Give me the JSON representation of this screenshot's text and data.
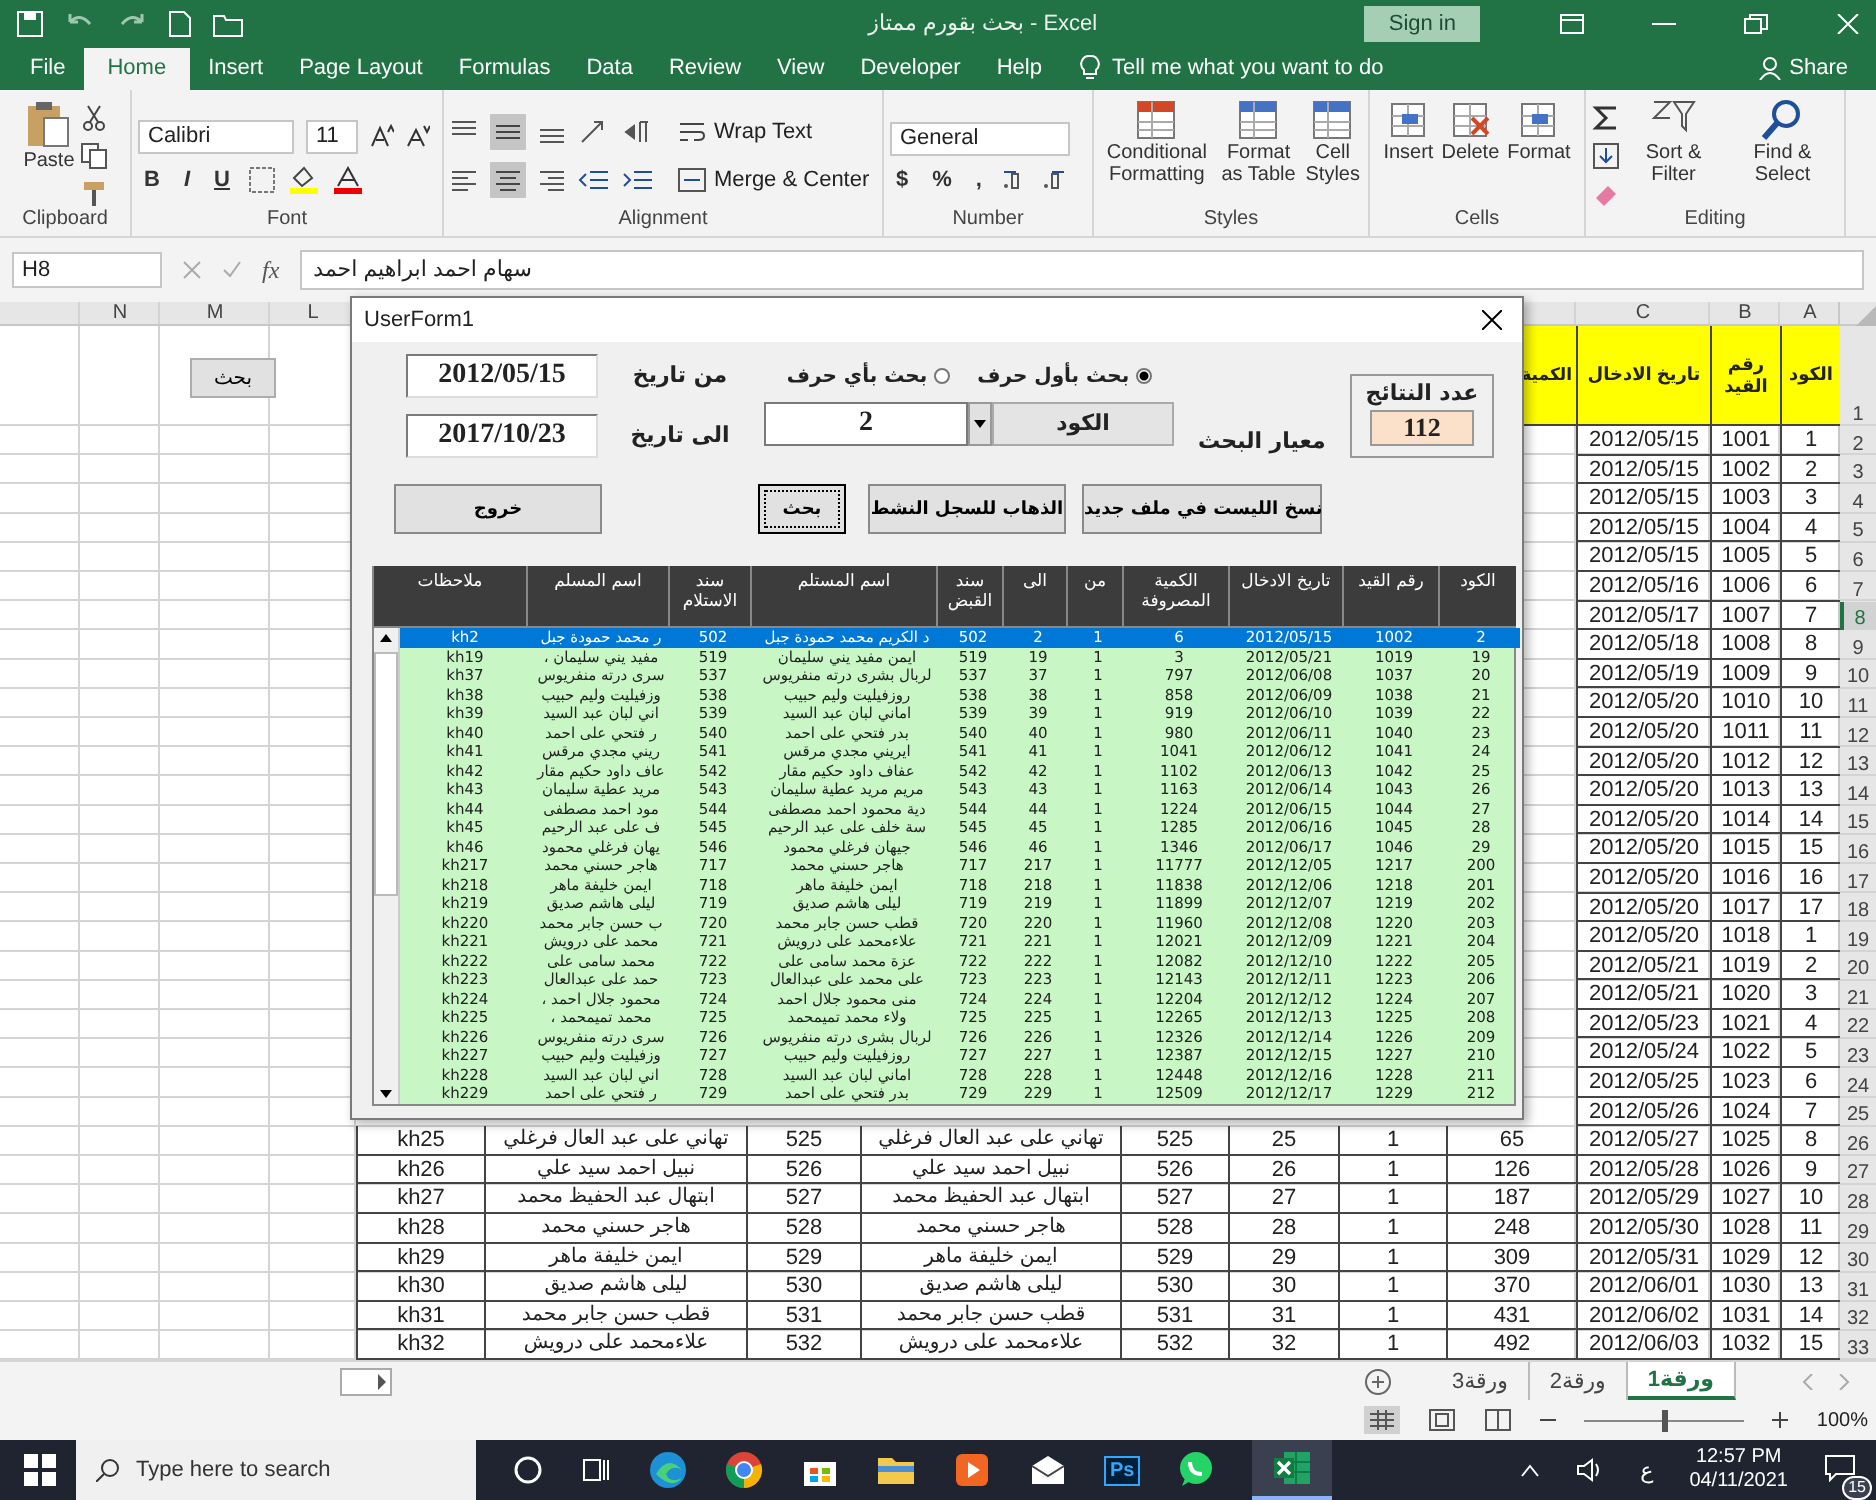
{
  "window": {
    "title": "بحث بقورم ممتاز - Excel",
    "sign_in": "Sign in"
  },
  "ribbon_tabs": [
    {
      "label": "File",
      "selected": false
    },
    {
      "label": "Home",
      "selected": true
    },
    {
      "label": "Insert",
      "selected": false
    },
    {
      "label": "Page Layout",
      "selected": false
    },
    {
      "label": "Formulas",
      "selected": false
    },
    {
      "label": "Data",
      "selected": false
    },
    {
      "label": "Review",
      "selected": false
    },
    {
      "label": "View",
      "selected": false
    },
    {
      "label": "Developer",
      "selected": false
    },
    {
      "label": "Help",
      "selected": false
    }
  ],
  "tell_me": "Tell me what you want to do",
  "share": "Share",
  "ribbon": {
    "clipboard": {
      "paste": "Paste",
      "label": "Clipboard"
    },
    "font": {
      "name": "Calibri",
      "size": "11",
      "styles": [
        "B",
        "I",
        "U"
      ],
      "label": "Font"
    },
    "alignment": {
      "wrap": "Wrap Text",
      "merge": "Merge & Center",
      "label": "Alignment"
    },
    "number": {
      "format": "General",
      "symbols": [
        "$",
        "%",
        ","
      ],
      "label": "Number"
    },
    "styles": {
      "buttons": [
        "Conditional Formatting",
        "Format as Table",
        "Cell Styles"
      ],
      "label": "Styles"
    },
    "cells": {
      "buttons": [
        "Insert",
        "Delete",
        "Format"
      ],
      "label": "Cells"
    },
    "editing": {
      "buttons": [
        "Sort & Filter",
        "Find & Select"
      ],
      "label": "Editing"
    }
  },
  "formula_bar": {
    "cell": "H8",
    "fx": "fx",
    "value": "سهام احمد ابراهيم احمد"
  },
  "sheet": {
    "columns_left": [
      "N",
      "M",
      "L"
    ],
    "columns_right": [
      "C",
      "B",
      "A"
    ],
    "button": "بحث",
    "cut_header": "الكمية",
    "rows": [
      {
        "n": "1",
        "selected": false,
        "cells": [
          "تاريخ الادخال",
          "رقم القيد",
          "الكود"
        ]
      },
      {
        "n": "2",
        "selected": false,
        "cells": [
          "2012/05/15",
          "1001",
          "1"
        ]
      },
      {
        "n": "3",
        "selected": false,
        "cells": [
          "2012/05/15",
          "1002",
          "2"
        ]
      },
      {
        "n": "4",
        "selected": false,
        "cells": [
          "2012/05/15",
          "1003",
          "3"
        ]
      },
      {
        "n": "5",
        "selected": false,
        "cells": [
          "2012/05/15",
          "1004",
          "4"
        ]
      },
      {
        "n": "6",
        "selected": false,
        "cells": [
          "2012/05/15",
          "1005",
          "5"
        ]
      },
      {
        "n": "7",
        "selected": false,
        "cells": [
          "2012/05/16",
          "1006",
          "6"
        ]
      },
      {
        "n": "8",
        "selected": true,
        "cells": [
          "2012/05/17",
          "1007",
          "7"
        ]
      },
      {
        "n": "9",
        "selected": false,
        "cells": [
          "2012/05/18",
          "1008",
          "8"
        ]
      },
      {
        "n": "10",
        "selected": false,
        "cells": [
          "2012/05/19",
          "1009",
          "9"
        ]
      },
      {
        "n": "11",
        "selected": false,
        "cells": [
          "2012/05/20",
          "1010",
          "10"
        ]
      },
      {
        "n": "12",
        "selected": false,
        "cells": [
          "2012/05/20",
          "1011",
          "11"
        ]
      },
      {
        "n": "13",
        "selected": false,
        "cells": [
          "2012/05/20",
          "1012",
          "12"
        ]
      },
      {
        "n": "14",
        "selected": false,
        "cells": [
          "2012/05/20",
          "1013",
          "13"
        ]
      },
      {
        "n": "15",
        "selected": false,
        "cells": [
          "2012/05/20",
          "1014",
          "14"
        ]
      },
      {
        "n": "16",
        "selected": false,
        "cells": [
          "2012/05/20",
          "1015",
          "15"
        ]
      },
      {
        "n": "17",
        "selected": false,
        "cells": [
          "2012/05/20",
          "1016",
          "16"
        ]
      },
      {
        "n": "18",
        "selected": false,
        "cells": [
          "2012/05/20",
          "1017",
          "17"
        ]
      },
      {
        "n": "19",
        "selected": false,
        "cells": [
          "2012/05/20",
          "1018",
          "1"
        ]
      },
      {
        "n": "20",
        "selected": false,
        "cells": [
          "2012/05/21",
          "1019",
          "2"
        ]
      },
      {
        "n": "21",
        "selected": false,
        "cells": [
          "2012/05/21",
          "1020",
          "3"
        ]
      },
      {
        "n": "22",
        "selected": false,
        "cells": [
          "2012/05/23",
          "1021",
          "4"
        ]
      },
      {
        "n": "23",
        "selected": false,
        "cells": [
          "2012/05/24",
          "1022",
          "5"
        ]
      },
      {
        "n": "24",
        "selected": false,
        "cells": [
          "2012/05/25",
          "1023",
          "6"
        ]
      },
      {
        "n": "25",
        "selected": false,
        "cells": [
          "2012/05/26",
          "1024",
          "7"
        ]
      },
      {
        "n": "26",
        "selected": false,
        "cells": [
          "kh25",
          "تهاني على عبد العال فرغلي",
          "525",
          "تهاني على عبد العال فرغلي",
          "525",
          "25",
          "1",
          "65",
          "2012/05/27",
          "1025",
          "8"
        ]
      },
      {
        "n": "27",
        "selected": false,
        "cells": [
          "kh26",
          "نبيل احمد سيد علي",
          "526",
          "نبيل احمد سيد علي",
          "526",
          "26",
          "1",
          "126",
          "2012/05/28",
          "1026",
          "9"
        ]
      },
      {
        "n": "28",
        "selected": false,
        "cells": [
          "kh27",
          "ابتهال عبد الحفيظ محمد",
          "527",
          "ابتهال عبد الحفيظ محمد",
          "527",
          "27",
          "1",
          "187",
          "2012/05/29",
          "1027",
          "10"
        ]
      },
      {
        "n": "29",
        "selected": false,
        "cells": [
          "kh28",
          "هاجر حسني محمد",
          "528",
          "هاجر حسني محمد",
          "528",
          "28",
          "1",
          "248",
          "2012/05/30",
          "1028",
          "11"
        ]
      },
      {
        "n": "30",
        "selected": false,
        "cells": [
          "kh29",
          "ايمن خليفة ماهر",
          "529",
          "ايمن خليفة ماهر",
          "529",
          "29",
          "1",
          "309",
          "2012/05/31",
          "1029",
          "12"
        ]
      },
      {
        "n": "31",
        "selected": false,
        "cells": [
          "kh30",
          "ليلى هاشم صديق",
          "530",
          "ليلى هاشم صديق",
          "530",
          "30",
          "1",
          "370",
          "2012/06/01",
          "1030",
          "13"
        ]
      },
      {
        "n": "32",
        "selected": false,
        "cells": [
          "kh31",
          "قطب حسن جابر محمد",
          "531",
          "قطب حسن جابر محمد",
          "531",
          "31",
          "1",
          "431",
          "2012/06/02",
          "1031",
          "14"
        ]
      },
      {
        "n": "33",
        "selected": false,
        "cells": [
          "kh32",
          "علاءمحمد على درويش",
          "532",
          "علاءمحمد على درويش",
          "532",
          "32",
          "1",
          "492",
          "2012/06/03",
          "1032",
          "15"
        ]
      }
    ]
  },
  "form": {
    "title": "UserForm1",
    "from_label": "من تاريخ",
    "from_value": "2012/05/15",
    "to_label": "الى تاريخ",
    "to_value": "2017/10/23",
    "radios": [
      {
        "label": "بحث بأول حرف",
        "selected": true
      },
      {
        "label": "بحث بأي حرف",
        "selected": false
      }
    ],
    "criterion_label": "معيار البحث",
    "criterion_field": "الكود",
    "search_value": "2",
    "results_label": "عدد النتائج",
    "results_count": "112",
    "buttons": [
      {
        "label": "نسخ الليست في ملف جديد",
        "focused": false
      },
      {
        "label": "الذهاب للسجل النشط",
        "focused": false
      },
      {
        "label": "بحث",
        "focused": true
      },
      {
        "label": "خروج",
        "focused": false
      }
    ],
    "list_columns": [
      "الكود",
      "رقم القيد",
      "تاريخ الادخال",
      "الكمية المصروفة",
      "من",
      "الى",
      "سند القبض",
      "اسم المستلم",
      "سند الاستلام",
      "اسم المسلم",
      "ملاحظات"
    ],
    "list_rows": [
      {
        "selected": true,
        "cells": [
          "kh2",
          "ر محمد حمودة جبل",
          "502",
          "د الكريم محمد حمودة جبل",
          "502",
          "2",
          "1",
          "6",
          "2012/05/15",
          "1002",
          "2"
        ]
      },
      {
        "selected": false,
        "cells": [
          "kh19",
          "، مفيد يني سليمان",
          "519",
          "ايمن مفيد يني سليمان",
          "519",
          "19",
          "1",
          "3",
          "2012/05/21",
          "1019",
          "19"
        ]
      },
      {
        "selected": false,
        "cells": [
          "kh37",
          "سرى درته منفريوس",
          "537",
          "لربال بشرى درته منفريوس",
          "537",
          "37",
          "1",
          "797",
          "2012/06/08",
          "1037",
          "20"
        ]
      },
      {
        "selected": false,
        "cells": [
          "kh38",
          "وزفيليت وليم حبيب",
          "538",
          "روزفيليت وليم حبيب",
          "538",
          "38",
          "1",
          "858",
          "2012/06/09",
          "1038",
          "21"
        ]
      },
      {
        "selected": false,
        "cells": [
          "kh39",
          "اني لبان عبد السيد",
          "539",
          "اماني لبان عبد السيد",
          "539",
          "39",
          "1",
          "919",
          "2012/06/10",
          "1039",
          "22"
        ]
      },
      {
        "selected": false,
        "cells": [
          "kh40",
          "ر فتحي على احمد",
          "540",
          "بدر فتحي على احمد",
          "540",
          "40",
          "1",
          "980",
          "2012/06/11",
          "1040",
          "23"
        ]
      },
      {
        "selected": false,
        "cells": [
          "kh41",
          "ريني مجدي مرقس",
          "541",
          "ايريني مجدي مرقس",
          "541",
          "41",
          "1",
          "1041",
          "2012/06/12",
          "1041",
          "24"
        ]
      },
      {
        "selected": false,
        "cells": [
          "kh42",
          "عاف داود حكيم مقار",
          "542",
          "عفاف داود حكيم مقار",
          "542",
          "42",
          "1",
          "1102",
          "2012/06/13",
          "1042",
          "25"
        ]
      },
      {
        "selected": false,
        "cells": [
          "kh43",
          "مريد عطية سليمان",
          "543",
          "مريم مريد عطية سليمان",
          "543",
          "43",
          "1",
          "1163",
          "2012/06/14",
          "1043",
          "26"
        ]
      },
      {
        "selected": false,
        "cells": [
          "kh44",
          "مود احمد مصطفى",
          "544",
          "دية محمود احمد مصطفى",
          "544",
          "44",
          "1",
          "1224",
          "2012/06/15",
          "1044",
          "27"
        ]
      },
      {
        "selected": false,
        "cells": [
          "kh45",
          "ف على عبد الرحيم",
          "545",
          "سة خلف على عبد الرحيم",
          "545",
          "45",
          "1",
          "1285",
          "2012/06/16",
          "1045",
          "28"
        ]
      },
      {
        "selected": false,
        "cells": [
          "kh46",
          "يهان فرغلي محمود",
          "546",
          "جيهان فرغلي محمود",
          "546",
          "46",
          "1",
          "1346",
          "2012/06/17",
          "1046",
          "29"
        ]
      },
      {
        "selected": false,
        "cells": [
          "kh217",
          "هاجر حسني محمد",
          "717",
          "هاجر حسني محمد",
          "717",
          "217",
          "1",
          "11777",
          "2012/12/05",
          "1217",
          "200"
        ]
      },
      {
        "selected": false,
        "cells": [
          "kh218",
          "ايمن خليفة ماهر",
          "718",
          "ايمن خليفة ماهر",
          "718",
          "218",
          "1",
          "11838",
          "2012/12/06",
          "1218",
          "201"
        ]
      },
      {
        "selected": false,
        "cells": [
          "kh219",
          "ليلى هاشم صديق",
          "719",
          "ليلى هاشم صديق",
          "719",
          "219",
          "1",
          "11899",
          "2012/12/07",
          "1219",
          "202"
        ]
      },
      {
        "selected": false,
        "cells": [
          "kh220",
          "ب حسن جابر محمد",
          "720",
          "قطب حسن جابر محمد",
          "720",
          "220",
          "1",
          "11960",
          "2012/12/08",
          "1220",
          "203"
        ]
      },
      {
        "selected": false,
        "cells": [
          "kh221",
          "محمد على درويش",
          "721",
          "علاءمحمد على درويش",
          "721",
          "221",
          "1",
          "12021",
          "2012/12/09",
          "1221",
          "204"
        ]
      },
      {
        "selected": false,
        "cells": [
          "kh222",
          "محمد سامى على",
          "722",
          "عزة محمد سامى على",
          "722",
          "222",
          "1",
          "12082",
          "2012/12/10",
          "1222",
          "205"
        ]
      },
      {
        "selected": false,
        "cells": [
          "kh223",
          "حمد على عبدالعال",
          "723",
          "على محمد على عبدالعال",
          "723",
          "223",
          "1",
          "12143",
          "2012/12/11",
          "1223",
          "206"
        ]
      },
      {
        "selected": false,
        "cells": [
          "kh224",
          "، محمود جلال احمد",
          "724",
          "منى محمود جلال احمد",
          "724",
          "224",
          "1",
          "12204",
          "2012/12/12",
          "1224",
          "207"
        ]
      },
      {
        "selected": false,
        "cells": [
          "kh225",
          "، محمد تميمحمد",
          "725",
          "ولاء محمد تميمحمد",
          "725",
          "225",
          "1",
          "12265",
          "2012/12/13",
          "1225",
          "208"
        ]
      },
      {
        "selected": false,
        "cells": [
          "kh226",
          "سرى درته منفريوس",
          "726",
          "لربال بشرى درته منفريوس",
          "726",
          "226",
          "1",
          "12326",
          "2012/12/14",
          "1226",
          "209"
        ]
      },
      {
        "selected": false,
        "cells": [
          "kh227",
          "وزفيليت وليم حبيب",
          "727",
          "روزفيليت وليم حبيب",
          "727",
          "227",
          "1",
          "12387",
          "2012/12/15",
          "1227",
          "210"
        ]
      },
      {
        "selected": false,
        "cells": [
          "kh228",
          "اني لبان عبد السيد",
          "728",
          "اماني لبان عبد السيد",
          "728",
          "228",
          "1",
          "12448",
          "2012/12/16",
          "1228",
          "211"
        ]
      },
      {
        "selected": false,
        "cells": [
          "kh229",
          "ر فتحي على احمد",
          "729",
          "بدر فتحي على احمد",
          "729",
          "229",
          "1",
          "12509",
          "2012/12/17",
          "1229",
          "212"
        ]
      }
    ]
  },
  "sheet_tabs": [
    {
      "label": "ورقة1",
      "selected": true
    },
    {
      "label": "ورقة2",
      "selected": false
    },
    {
      "label": "ورقة3",
      "selected": false
    }
  ],
  "status_bar": {
    "zoom": {
      "label": "100%",
      "level": 0.5
    }
  },
  "taskbar": {
    "search_placeholder": "Type here to search",
    "ps": "Ps",
    "language": "ع",
    "time": "12:57 PM",
    "date": "04/11/2021",
    "notifications": "15"
  }
}
